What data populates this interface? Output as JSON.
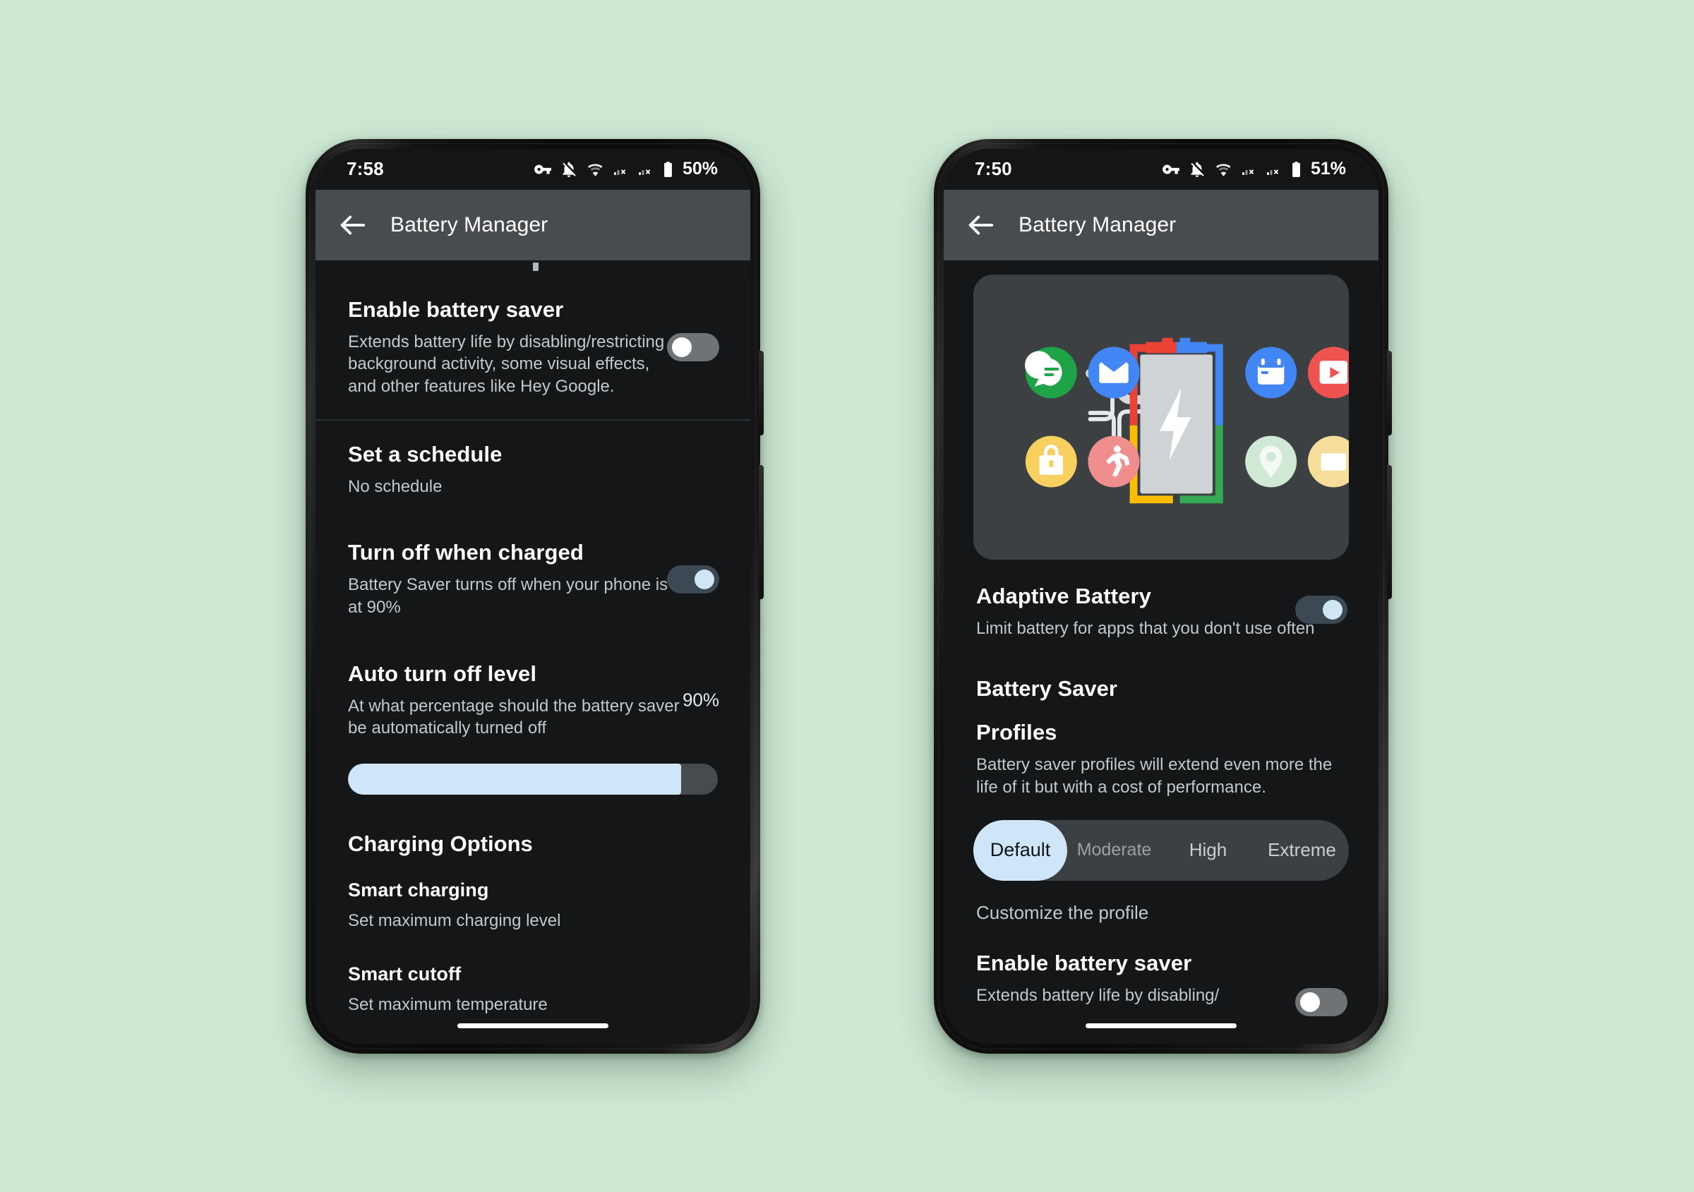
{
  "background_color": "#cde8d3",
  "accent_color": "#cfe6f8",
  "phones": [
    {
      "id": "left",
      "status_bar": {
        "time": "7:58",
        "battery_label": "50%",
        "icons": [
          "vpn-key-icon",
          "notifications-off-icon",
          "wifi-icon",
          "signal-no-service-icon",
          "signal-no-service-icon",
          "battery-icon"
        ]
      },
      "app_bar": {
        "back_label": "Back",
        "title": "Battery Manager"
      },
      "rows": [
        {
          "title": "Enable battery saver",
          "subtitle": "Extends battery life by disabling/restricting background activity, some visual effects, and other features like Hey Google.",
          "control": "toggle",
          "toggle_state": "off"
        },
        {
          "title": "Set a schedule",
          "subtitle": "No schedule",
          "control": "none"
        },
        {
          "title": "Turn off when charged",
          "subtitle": "Battery Saver turns off when your phone is at 90%",
          "control": "toggle",
          "toggle_state": "on"
        },
        {
          "title": "Auto turn off level",
          "subtitle": "At what percentage should the battery saver be automatically turned off",
          "control": "value",
          "value": "90%"
        }
      ],
      "slider": {
        "name": "auto-turn-off-level-slider",
        "percent": 90
      },
      "section_heading": "Charging Options",
      "options": [
        {
          "title": "Smart charging",
          "subtitle": "Set maximum charging level"
        },
        {
          "title": "Smart cutoff",
          "subtitle": "Set maximum temperature"
        }
      ]
    },
    {
      "id": "right",
      "status_bar": {
        "time": "7:50",
        "battery_label": "51%",
        "icons": [
          "vpn-key-icon",
          "notifications-off-icon",
          "wifi-icon",
          "signal-no-service-icon",
          "signal-no-service-icon",
          "battery-icon"
        ]
      },
      "app_bar": {
        "back_label": "Back",
        "title": "Battery Manager"
      },
      "illustration": {
        "name": "adaptive-battery-illustration",
        "center": "battery-with-bolt",
        "battery_border_colors": [
          "#ea4335",
          "#4285f4",
          "#34a853",
          "#fbbc04"
        ],
        "app_icons_left": [
          {
            "name": "messages-icon",
            "color": "#1ea446"
          },
          {
            "name": "gmail-icon",
            "color": "#4285f4"
          },
          {
            "name": "keep-icon",
            "color": "#f7d060"
          },
          {
            "name": "fit-icon",
            "color": "#f08d8d"
          }
        ],
        "app_icons_right": [
          {
            "name": "calendar-icon",
            "color": "#4285f4"
          },
          {
            "name": "youtube-icon",
            "color": "#ef5350"
          },
          {
            "name": "maps-icon",
            "color": "#cfe9d4"
          },
          {
            "name": "photos-icon",
            "color": "#f7dd9a"
          }
        ]
      },
      "rows": [
        {
          "title": "Adaptive Battery",
          "subtitle": "Limit battery for apps that you don't use often",
          "control": "toggle",
          "toggle_state": "on"
        }
      ],
      "battery_saver_heading": "Battery Saver",
      "profiles": {
        "title": "Profiles",
        "subtitle": "Battery saver profiles will extend even more the life of it but with a cost of performance.",
        "options": [
          "Default",
          "Moderate",
          "High",
          "Extreme"
        ],
        "selected": "Default",
        "customize_label": "Customize the profile"
      },
      "bottom_row": {
        "title": "Enable battery saver",
        "subtitle": "Extends battery life by disabling/",
        "control": "toggle",
        "toggle_state": "off"
      }
    }
  ]
}
